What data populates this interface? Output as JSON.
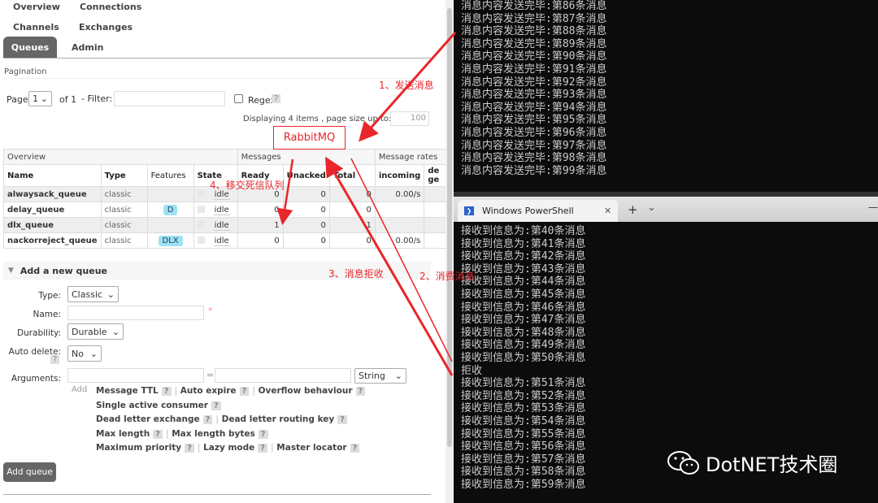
{
  "nav": {
    "items": [
      "Overview",
      "Connections",
      "Channels",
      "Exchanges",
      "Queues",
      "Admin"
    ],
    "active": "Queues"
  },
  "pagination": {
    "title": "Pagination",
    "page_label": "Page",
    "page_value": "1",
    "of_label": "of 1",
    "filter_label": "- Filter:",
    "filter_value": "",
    "regex_label": "Regex",
    "help": "?",
    "displaying": "Displaying 4 items , page size up to:",
    "page_size": "100"
  },
  "table": {
    "groups": [
      "Overview",
      "Messages",
      "Message rates"
    ],
    "headers": [
      "Name",
      "Type",
      "Features",
      "State",
      "Ready",
      "Unacked",
      "Total",
      "incoming",
      "de ge"
    ],
    "rows": [
      {
        "name": "alwaysack_queue",
        "type": "classic",
        "features": "",
        "state": "idle",
        "ready": "0",
        "unacked": "0",
        "total": "0",
        "incoming": "0.00/s"
      },
      {
        "name": "delay_queue",
        "type": "classic",
        "features": "D",
        "state": "idle",
        "ready": "0",
        "unacked": "0",
        "total": "0",
        "incoming": ""
      },
      {
        "name": "dlx_queue",
        "type": "classic",
        "features": "",
        "state": "idle",
        "ready": "1",
        "unacked": "0",
        "total": "1",
        "incoming": ""
      },
      {
        "name": "nackorreject_queue",
        "type": "classic",
        "features": "DLX",
        "state": "idle",
        "ready": "0",
        "unacked": "0",
        "total": "0",
        "incoming": "0.00/s"
      }
    ]
  },
  "add_queue": {
    "title": "Add a new queue",
    "type_label": "Type:",
    "type_value": "Classic",
    "name_label": "Name:",
    "name_value": "",
    "required": "*",
    "durability_label": "Durability:",
    "durability_value": "Durable",
    "autodelete_label": "Auto delete:",
    "autodelete_value": "No",
    "arguments_label": "Arguments:",
    "eq": "=",
    "arg_type": "String",
    "add_link": "Add",
    "args": [
      [
        "Message TTL",
        "Auto expire",
        "Overflow behaviour"
      ],
      [
        "Single active consumer"
      ],
      [
        "Dead letter exchange",
        "Dead letter routing key"
      ],
      [
        "Max length",
        "Max length bytes"
      ],
      [
        "Maximum priority",
        "Lazy mode",
        "Master locator"
      ]
    ],
    "button": "Add queue"
  },
  "terminal_top": {
    "lines": [
      "消息内容发送完毕:第86条消息",
      "消息内容发送完毕:第87条消息",
      "消息内容发送完毕:第88条消息",
      "消息内容发送完毕:第89条消息",
      "消息内容发送完毕:第90条消息",
      "消息内容发送完毕:第91条消息",
      "消息内容发送完毕:第92条消息",
      "消息内容发送完毕:第93条消息",
      "消息内容发送完毕:第94条消息",
      "消息内容发送完毕:第95条消息",
      "消息内容发送完毕:第96条消息",
      "消息内容发送完毕:第97条消息",
      "消息内容发送完毕:第98条消息",
      "消息内容发送完毕:第99条消息"
    ]
  },
  "terminal_bottom": {
    "tab_title": "Windows PowerShell",
    "close": "✕",
    "new_tab": "+",
    "dropdown": "⌄",
    "minimize": "—",
    "lines": [
      "接收到信息为:第40条消息",
      "接收到信息为:第41条消息",
      "接收到信息为:第42条消息",
      "接收到信息为:第43条消息",
      "接收到信息为:第44条消息",
      "接收到信息为:第45条消息",
      "接收到信息为:第46条消息",
      "接收到信息为:第47条消息",
      "接收到信息为:第48条消息",
      "接收到信息为:第49条消息",
      "接收到信息为:第50条消息",
      "拒收",
      "接收到信息为:第51条消息",
      "接收到信息为:第52条消息",
      "接收到信息为:第53条消息",
      "接收到信息为:第54条消息",
      "接收到信息为:第55条消息",
      "接收到信息为:第56条消息",
      "接收到信息为:第57条消息",
      "接收到信息为:第58条消息",
      "接收到信息为:第59条消息"
    ]
  },
  "annotations": {
    "box": "RabbitMQ",
    "step1": "1、发送消息",
    "step2": "2、消费消息",
    "step3": "3、消息拒收",
    "step4": "4、移交死信队列",
    "color": "#e8262b"
  },
  "watermark": {
    "text": "DotNET技术圈",
    "icon": "wechat-icon"
  }
}
